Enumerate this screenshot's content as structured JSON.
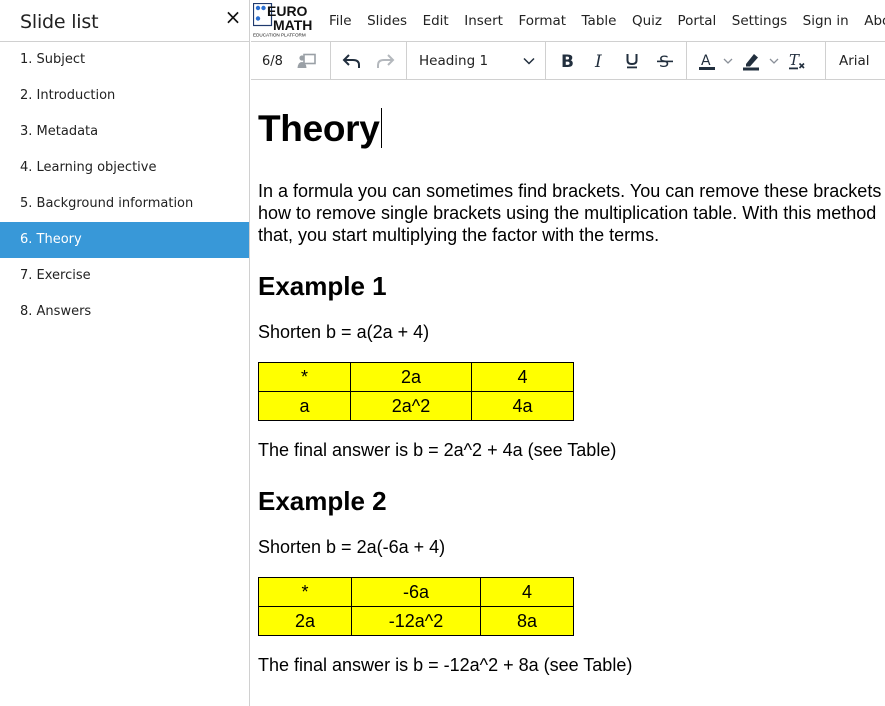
{
  "sidebar": {
    "title": "Slide list",
    "close_label": "×",
    "items": [
      {
        "label": "1. Subject",
        "active": false
      },
      {
        "label": "2. Introduction",
        "active": false
      },
      {
        "label": "3. Metadata",
        "active": false
      },
      {
        "label": "4. Learning objective",
        "active": false
      },
      {
        "label": "5. Background information",
        "active": false
      },
      {
        "label": "6. Theory",
        "active": true
      },
      {
        "label": "7. Exercise",
        "active": false
      },
      {
        "label": "8. Answers",
        "active": false
      }
    ]
  },
  "logo": {
    "line1": "EURO",
    "line2": "MATH",
    "tagline": "EDUCATION PLATFORM"
  },
  "menubar": {
    "items": [
      "File",
      "Slides",
      "Edit",
      "Insert",
      "Format",
      "Table",
      "Quiz",
      "Portal",
      "Settings",
      "Sign in",
      "About"
    ]
  },
  "toolbar": {
    "page_count": "6/8",
    "block_format": "Heading 1",
    "font_family": "Arial",
    "icons": [
      "presenter-icon",
      "undo-icon",
      "redo-icon",
      "bold-icon",
      "italic-icon",
      "underline-icon",
      "strikethrough-icon",
      "text-color-icon",
      "highlight-color-icon",
      "clear-formatting-icon"
    ]
  },
  "colors": {
    "accent": "#3898d8",
    "table_fill": "#ffff00",
    "icon_dark": "#222f3e"
  },
  "document": {
    "title": "Theory",
    "intro_lines": [
      "In a formula you can sometimes find brackets. You can remove these brackets",
      "how to remove single brackets using the multiplication table. With this method",
      "that, you start multiplying the factor with the terms."
    ],
    "examples": [
      {
        "heading": "Example 1",
        "problem": "Shorten b = a(2a + 4)",
        "table": [
          [
            "*",
            "2a",
            "4"
          ],
          [
            "a",
            "2a^2",
            "4a"
          ]
        ],
        "answer": "The final answer is b = 2a^2 + 4a (see Table)"
      },
      {
        "heading": "Example 2",
        "problem": "Shorten b = 2a(-6a + 4)",
        "table": [
          [
            "*",
            "-6a",
            "4"
          ],
          [
            "2a",
            "-12a^2",
            "8a"
          ]
        ],
        "answer": "The final answer is b = -12a^2 + 8a (see Table)"
      }
    ]
  }
}
